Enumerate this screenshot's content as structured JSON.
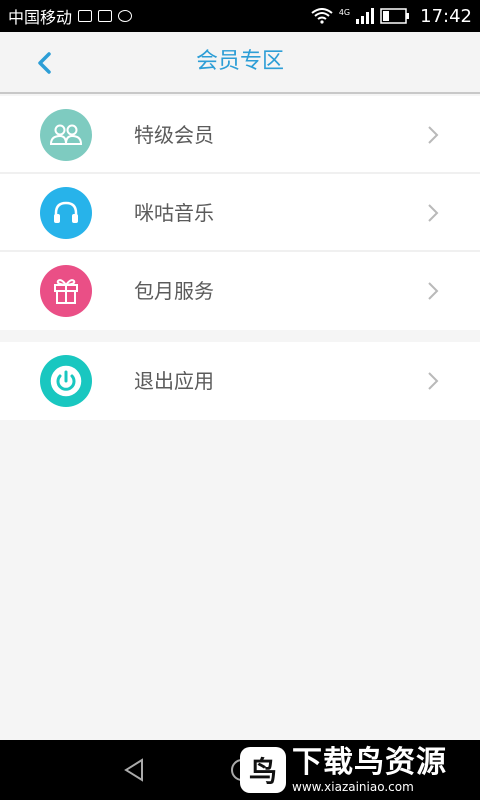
{
  "status_bar": {
    "carrier": "中国移动",
    "network_type": "4G",
    "time": "17:42"
  },
  "header": {
    "title": "会员专区"
  },
  "menu": [
    {
      "label": "特级会员",
      "icon": "members-icon",
      "color": "#7ecbc0"
    },
    {
      "label": "咪咕音乐",
      "icon": "headphones-icon",
      "color": "#27b3ea"
    },
    {
      "label": "包月服务",
      "icon": "gift-icon",
      "color": "#ea4f86"
    }
  ],
  "secondary_menu": [
    {
      "label": "退出应用",
      "icon": "power-icon",
      "color": "#19c7c0"
    }
  ],
  "watermark": {
    "title": "下载鸟资源",
    "url": "www.xiazainiao.com"
  },
  "colors": {
    "accent": "#2d9ed6",
    "text": "#5b5b5b",
    "background": "#f5f5f5"
  }
}
